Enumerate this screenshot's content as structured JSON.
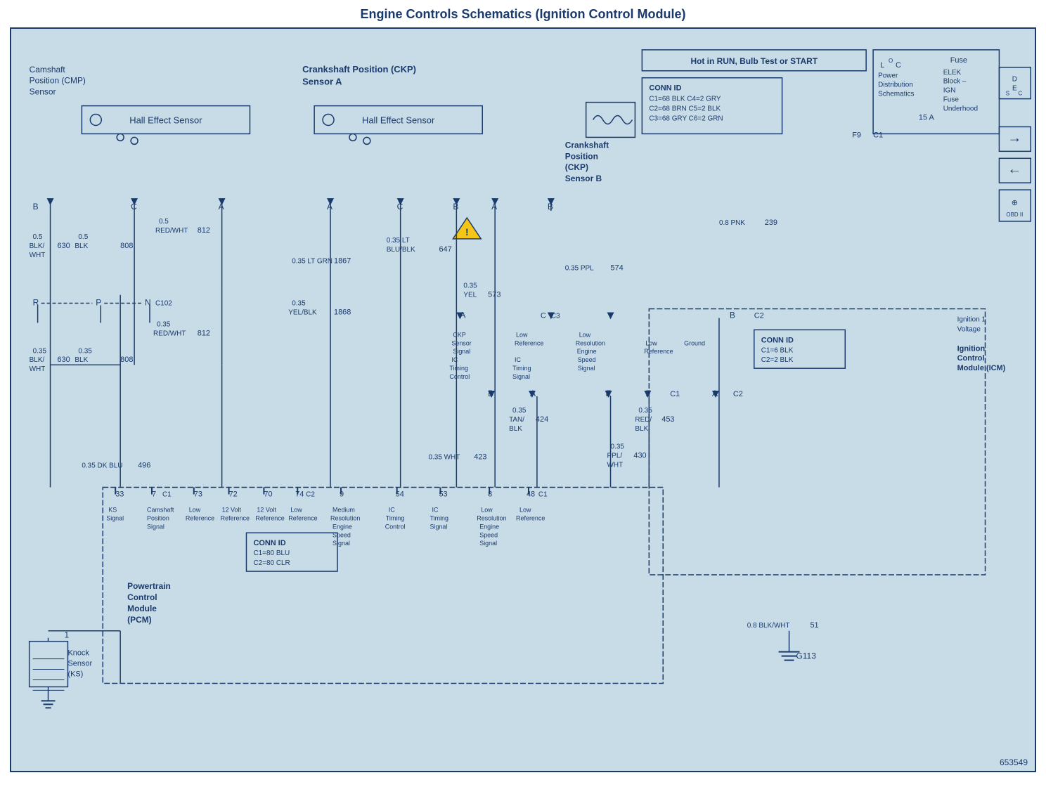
{
  "title": "Engine Controls Schematics (Ignition Control Module)",
  "footer": "653549",
  "diagram": {
    "background": "#c8dce8",
    "lineColor": "#1a3a6b",
    "textColor": "#1a3a6b"
  }
}
